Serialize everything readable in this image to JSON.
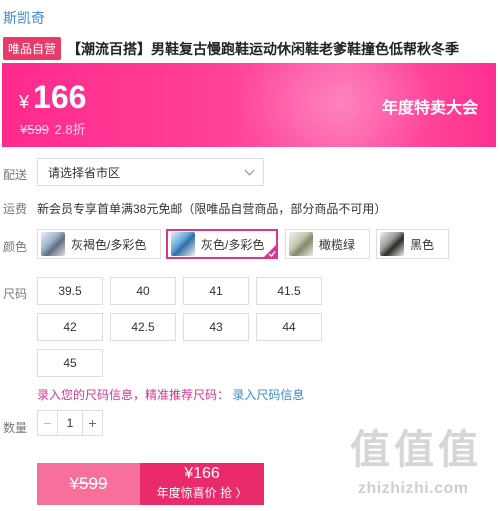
{
  "brand": "斯凯奇",
  "badge": "唯品自营",
  "title": "【潮流百搭】男鞋复古慢跑鞋运动休闲鞋老爹鞋撞色低帮秋冬季",
  "banner": {
    "currency": "¥",
    "price": "166",
    "original_price": "¥599",
    "discount": "2.8折",
    "event": "年度特卖大会",
    "colors": {
      "start": "#ff2a8d",
      "end": "#ff5ba8"
    }
  },
  "delivery": {
    "label": "配送",
    "select_value": "请选择省市区"
  },
  "shipping": {
    "label": "运费",
    "text": "新会员专享首单满38元免邮（限唯品自营商品，部分商品不可用）"
  },
  "color": {
    "label": "颜色",
    "options": [
      {
        "name": "灰褐色/多彩色",
        "selected": false
      },
      {
        "name": "灰色/多彩色",
        "selected": true
      },
      {
        "name": "橄榄绿",
        "selected": false
      },
      {
        "name": "黑色",
        "selected": false
      }
    ]
  },
  "size": {
    "label": "尺码",
    "options": [
      "39.5",
      "40",
      "41",
      "41.5",
      "42",
      "42.5",
      "43",
      "44",
      "45"
    ],
    "tip_prefix": "录入您的尺码信息，精准推荐尺码：",
    "tip_link": "录入尺码信息"
  },
  "quantity": {
    "label": "数量",
    "minus": "−",
    "value": "1",
    "plus": "+"
  },
  "buy": {
    "original_price": "¥599",
    "price": "¥166",
    "cta": "年度惊喜价 抢 〉",
    "colors": {
      "original_bg": "#f7709c",
      "main_bg": "#ea2b6b"
    }
  },
  "watermark": {
    "glyphs": [
      "值",
      "值",
      "值"
    ],
    "url": "zhizhizhi.com"
  }
}
